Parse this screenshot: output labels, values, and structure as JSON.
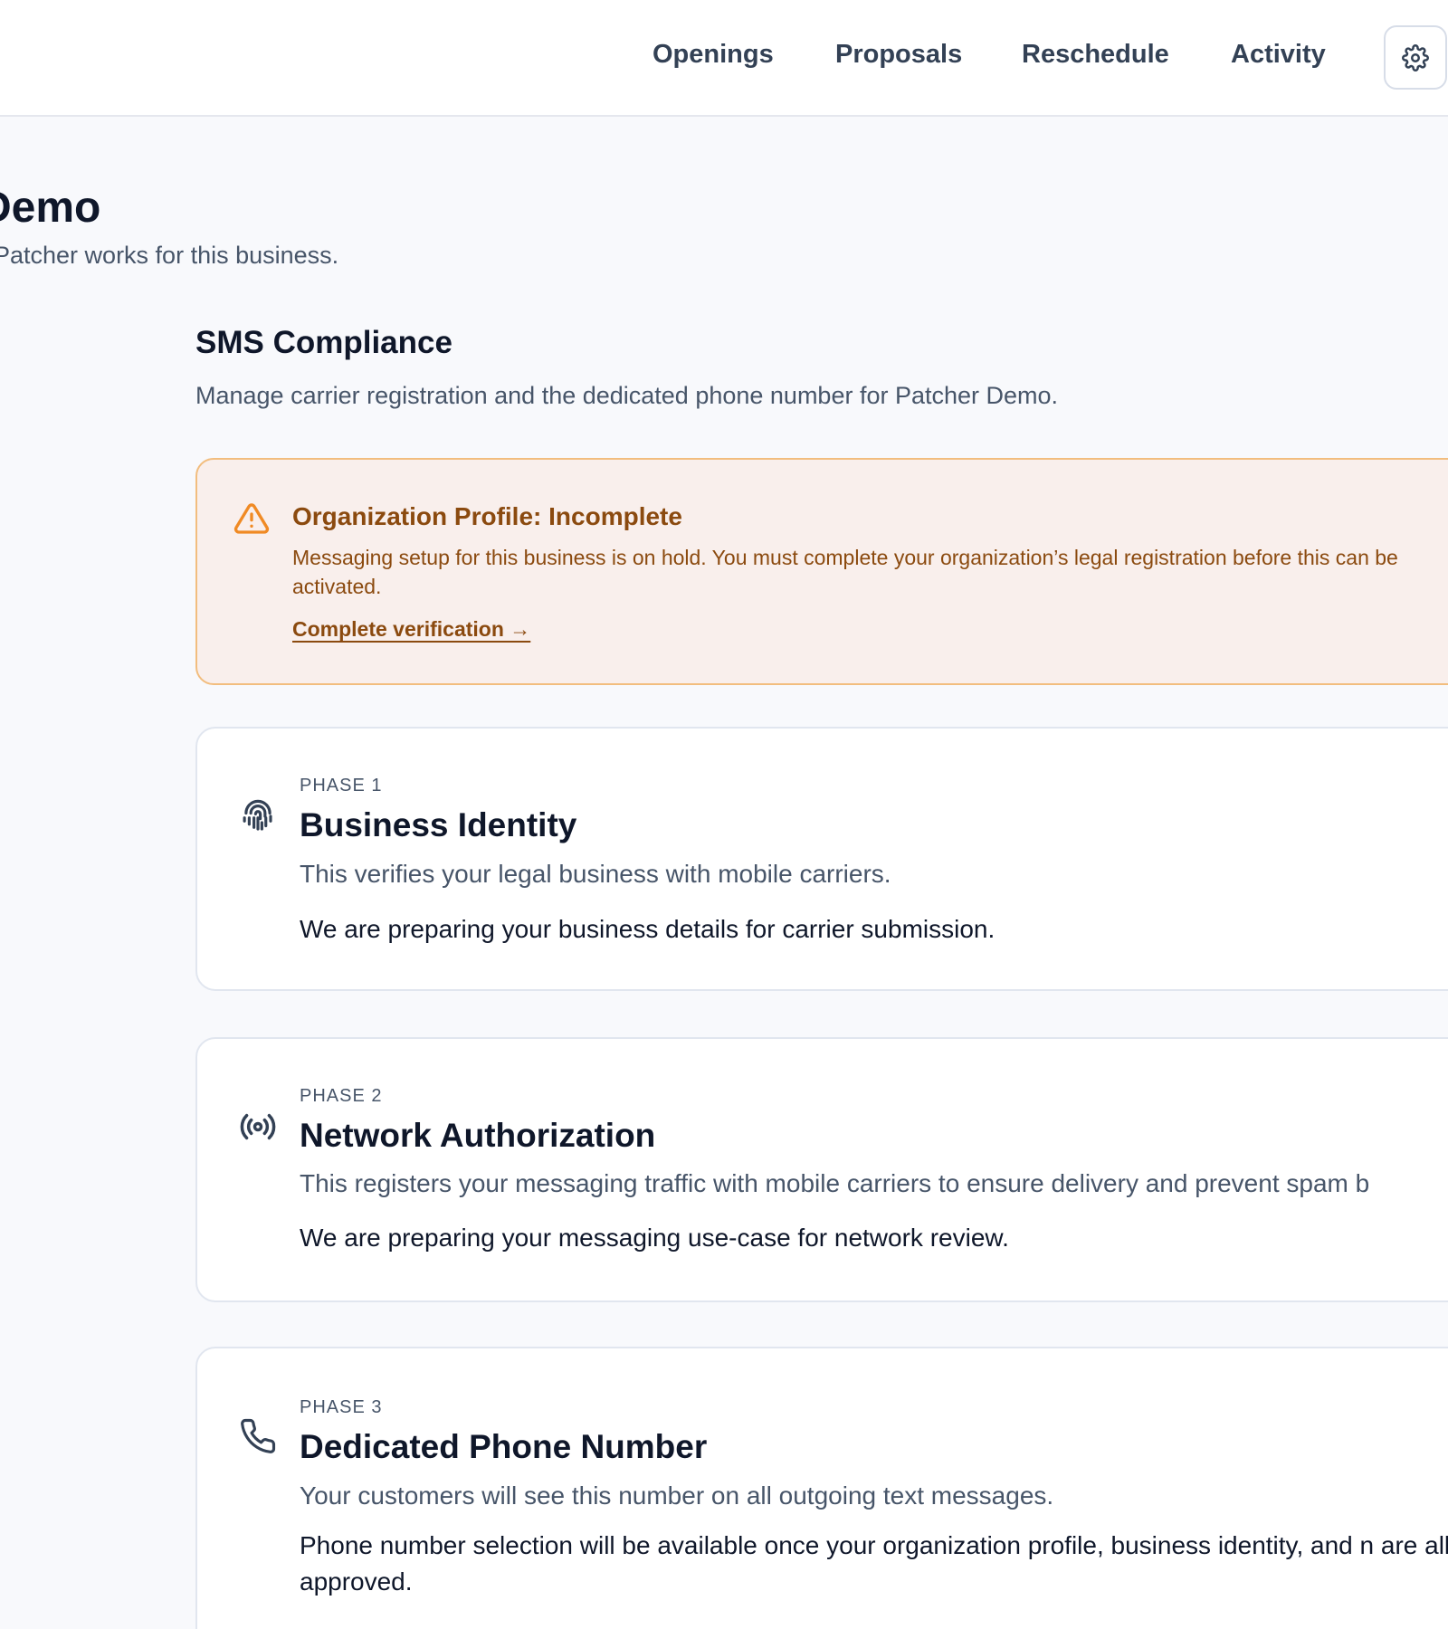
{
  "nav": {
    "items": [
      "Openings",
      "Proposals",
      "Reschedule",
      "Activity"
    ],
    "settings_icon": "gear-icon"
  },
  "page": {
    "title": "Demo",
    "subtitle": "Patcher works for this business."
  },
  "section": {
    "title": "SMS Compliance",
    "description": "Manage carrier registration and the dedicated phone number for Patcher Demo."
  },
  "alert": {
    "icon": "warning-triangle-icon",
    "title": "Organization Profile: Incomplete",
    "body": "Messaging setup for this business is on hold. You must complete your organization’s legal registration before this can be activated.",
    "link": "Complete verification →",
    "colors": {
      "background": "#f9efec",
      "border": "#f2bd7e",
      "text": "#8b4a0f",
      "icon": "#f08a24"
    }
  },
  "phases": [
    {
      "icon": "fingerprint-icon",
      "label": "PHASE 1",
      "title": "Business Identity",
      "description": "This verifies your legal business with mobile carriers.",
      "status": "We are preparing your business details for carrier submission."
    },
    {
      "icon": "broadcast-signal-icon",
      "label": "PHASE 2",
      "title": "Network Authorization",
      "description": "This registers your messaging traffic with mobile carriers to ensure delivery and prevent spam b",
      "status": "We are preparing your messaging use-case for network review."
    },
    {
      "icon": "phone-icon",
      "label": "PHASE 3",
      "title": "Dedicated Phone Number",
      "description": "Your customers will see this number on all outgoing text messages.",
      "status": "Phone number selection will be available once your organization profile, business identity, and n are all approved."
    }
  ],
  "colors": {
    "page_background": "#f8f9fc",
    "text_primary": "#0f172a",
    "text_secondary": "#475569"
  }
}
